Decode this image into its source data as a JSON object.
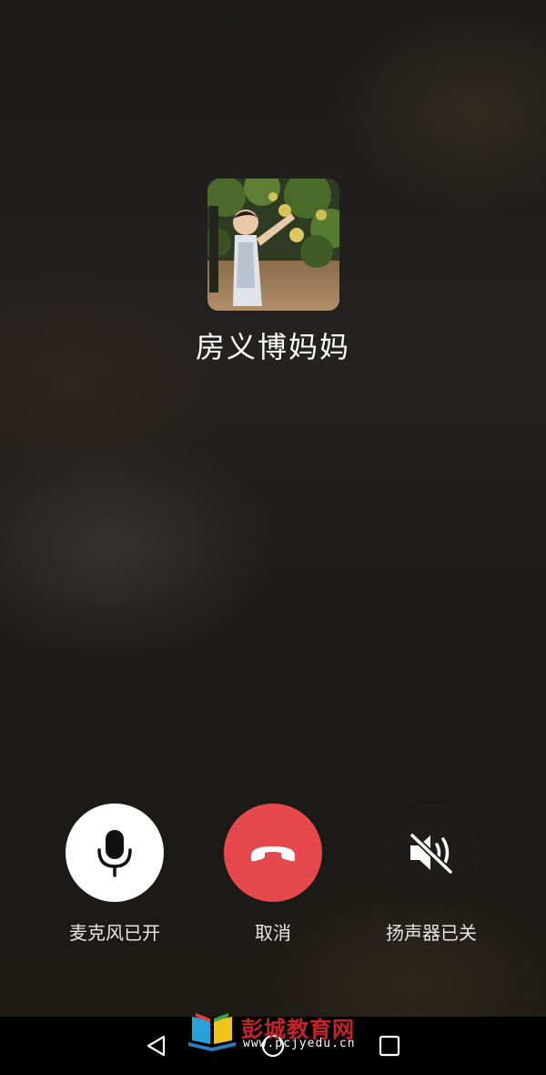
{
  "call": {
    "caller_name": "房义博妈妈"
  },
  "controls": {
    "mic": {
      "label": "麦克风已开",
      "icon": "microphone-icon",
      "bg": "#ffffff"
    },
    "cancel": {
      "label": "取消",
      "icon": "hang-up-phone-icon",
      "bg": "#e5484d"
    },
    "speaker": {
      "label": "扬声器已关",
      "icon": "speaker-muted-icon",
      "bg": "#1f1d1b"
    }
  },
  "nav": {
    "icons": [
      "back-triangle-icon",
      "home-circle-icon",
      "recents-square-icon"
    ]
  },
  "watermark": {
    "title": "彭城教育网",
    "url": "www.pcjyedu.cn"
  }
}
